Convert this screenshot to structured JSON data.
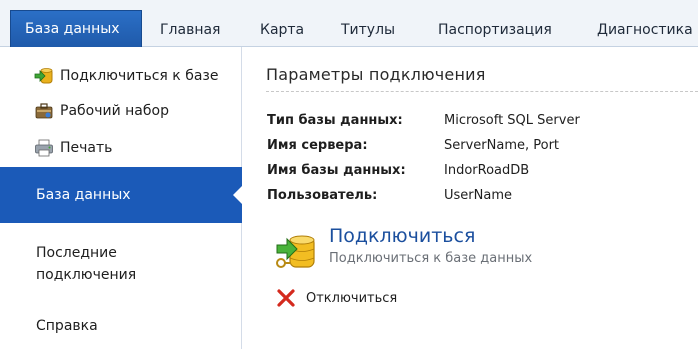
{
  "tabs": [
    {
      "label": "База данных",
      "active": true
    },
    {
      "label": "Главная"
    },
    {
      "label": "Карта"
    },
    {
      "label": "Титулы"
    },
    {
      "label": "Паспортизация"
    },
    {
      "label": "Диагностика"
    }
  ],
  "sidebar": {
    "commands": [
      {
        "label": "Подключиться к базе",
        "icon": "connect-database-icon"
      },
      {
        "label": "Рабочий набор",
        "icon": "work-set-icon"
      },
      {
        "label": "Печать",
        "icon": "printer-icon"
      }
    ],
    "nav": {
      "active": "База данных",
      "recent": "Последние подключения",
      "help": "Справка"
    }
  },
  "content": {
    "title": "Параметры подключения",
    "params": [
      {
        "label": "Тип базы данных:",
        "value": "Microsoft SQL Server"
      },
      {
        "label": "Имя сервера:",
        "value": "ServerName, Port"
      },
      {
        "label": "Имя базы данных:",
        "value": "IndorRoadDB"
      },
      {
        "label": "Пользователь:",
        "value": "UserName"
      }
    ],
    "connect": {
      "title": "Подключиться",
      "subtitle": "Подключиться к базе данных",
      "icon": "database-connect-icon"
    },
    "disconnect": {
      "label": "Отключиться",
      "icon": "red-x-icon"
    }
  },
  "colors": {
    "accent": "#1b5ab8",
    "link": "#1b4f9e",
    "disconnect_icon": "#d42a1e"
  }
}
